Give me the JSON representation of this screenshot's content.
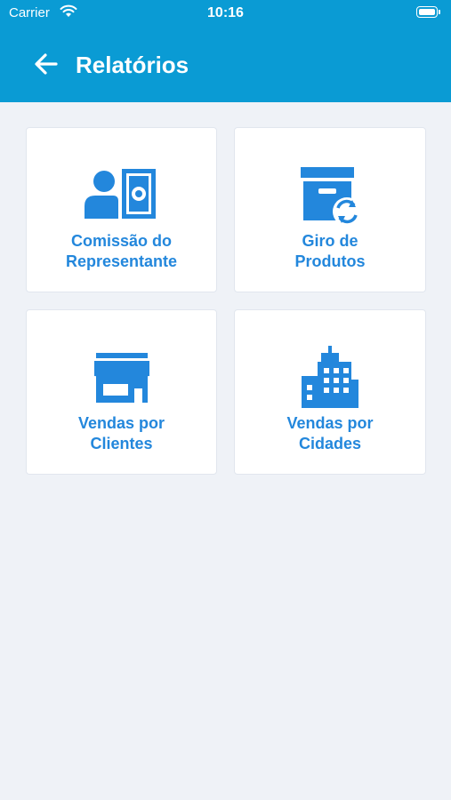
{
  "status_bar": {
    "carrier": "Carrier",
    "time": "10:16"
  },
  "header": {
    "title": "Relatórios",
    "back_icon": "arrow-left-icon"
  },
  "tiles": [
    {
      "line1": "Comissão do",
      "line2": "Representante",
      "icon": "commission-icon"
    },
    {
      "line1": "Giro de",
      "line2": "Produtos",
      "icon": "inventory-turnover-icon"
    },
    {
      "line1": "Vendas por",
      "line2": "Clientes",
      "icon": "storefront-icon"
    },
    {
      "line1": "Vendas por",
      "line2": "Cidades",
      "icon": "city-buildings-icon"
    }
  ],
  "colors": {
    "header": "#0a9bd4",
    "accent": "#2387dc",
    "background": "#eff2f7",
    "tile": "#ffffff"
  }
}
